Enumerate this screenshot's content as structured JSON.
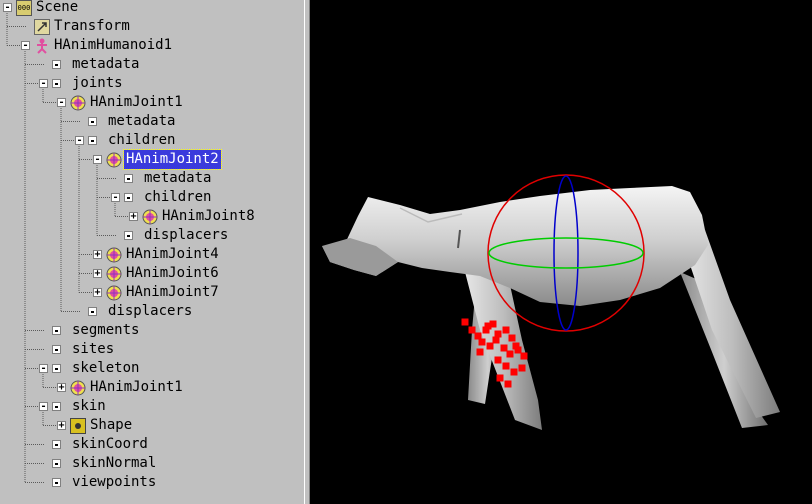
{
  "tree": {
    "nodes": [
      {
        "label": "Scene",
        "indent": 0,
        "expander": "-",
        "icon": "scene-icon"
      },
      {
        "label": "Transform",
        "indent": 1,
        "expander": "",
        "icon": "transform-icon"
      },
      {
        "label": "HAnimHumanoid1",
        "indent": 1,
        "expander": "-",
        "icon": "humanoid-icon"
      },
      {
        "label": "metadata",
        "indent": 2,
        "expander": "",
        "icon": "field-icon"
      },
      {
        "label": "joints",
        "indent": 2,
        "expander": "-",
        "icon": "field-icon"
      },
      {
        "label": "HAnimJoint1",
        "indent": 3,
        "expander": "-",
        "icon": "joint-icon"
      },
      {
        "label": "metadata",
        "indent": 4,
        "expander": "",
        "icon": "field-icon"
      },
      {
        "label": "children",
        "indent": 4,
        "expander": "-",
        "icon": "field-icon"
      },
      {
        "label": "HAnimJoint2",
        "indent": 5,
        "expander": "-",
        "icon": "joint-icon",
        "selected": true
      },
      {
        "label": "metadata",
        "indent": 6,
        "expander": "",
        "icon": "field-icon"
      },
      {
        "label": "children",
        "indent": 6,
        "expander": "-",
        "icon": "field-icon"
      },
      {
        "label": "HAnimJoint8",
        "indent": 7,
        "expander": "+",
        "icon": "joint-icon"
      },
      {
        "label": "displacers",
        "indent": 6,
        "expander": "",
        "icon": "field-icon"
      },
      {
        "label": "HAnimJoint4",
        "indent": 5,
        "expander": "+",
        "icon": "joint-icon"
      },
      {
        "label": "HAnimJoint6",
        "indent": 5,
        "expander": "+",
        "icon": "joint-icon"
      },
      {
        "label": "HAnimJoint7",
        "indent": 5,
        "expander": "+",
        "icon": "joint-icon"
      },
      {
        "label": "displacers",
        "indent": 4,
        "expander": "",
        "icon": "field-icon"
      },
      {
        "label": "segments",
        "indent": 2,
        "expander": "",
        "icon": "field-icon"
      },
      {
        "label": "sites",
        "indent": 2,
        "expander": "",
        "icon": "field-icon"
      },
      {
        "label": "skeleton",
        "indent": 2,
        "expander": "-",
        "icon": "field-icon"
      },
      {
        "label": "HAnimJoint1",
        "indent": 3,
        "expander": "+",
        "icon": "joint-icon"
      },
      {
        "label": "skin",
        "indent": 2,
        "expander": "-",
        "icon": "field-icon"
      },
      {
        "label": "Shape",
        "indent": 3,
        "expander": "+",
        "icon": "shape-icon"
      },
      {
        "label": "skinCoord",
        "indent": 2,
        "expander": "",
        "icon": "field-icon"
      },
      {
        "label": "skinNormal",
        "indent": 2,
        "expander": "",
        "icon": "field-icon"
      },
      {
        "label": "viewpoints",
        "indent": 2,
        "expander": "",
        "icon": "field-icon"
      }
    ]
  },
  "viewport": {
    "background": "#000000",
    "joint_sphere_color": "#e00000",
    "joint_ring_vertical_color": "#0000cc",
    "joint_ring_horizontal_color": "#00cc00",
    "skin_vertex_marker_color": "#ff0000",
    "skin_vertex_count": 24
  }
}
